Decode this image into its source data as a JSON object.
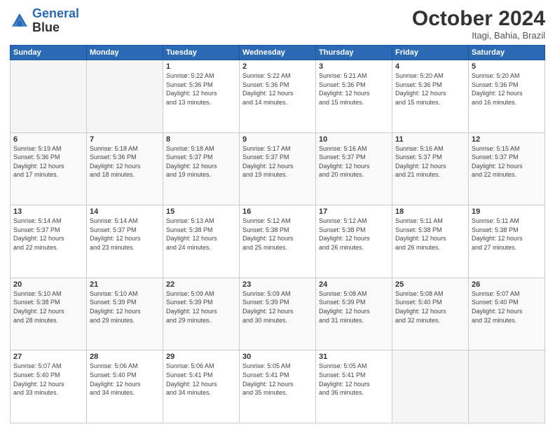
{
  "header": {
    "logo_line1": "General",
    "logo_line2": "Blue",
    "month": "October 2024",
    "location": "Itagi, Bahia, Brazil"
  },
  "weekdays": [
    "Sunday",
    "Monday",
    "Tuesday",
    "Wednesday",
    "Thursday",
    "Friday",
    "Saturday"
  ],
  "weeks": [
    [
      {
        "num": "",
        "info": ""
      },
      {
        "num": "",
        "info": ""
      },
      {
        "num": "1",
        "info": "Sunrise: 5:22 AM\nSunset: 5:36 PM\nDaylight: 12 hours\nand 13 minutes."
      },
      {
        "num": "2",
        "info": "Sunrise: 5:22 AM\nSunset: 5:36 PM\nDaylight: 12 hours\nand 14 minutes."
      },
      {
        "num": "3",
        "info": "Sunrise: 5:21 AM\nSunset: 5:36 PM\nDaylight: 12 hours\nand 15 minutes."
      },
      {
        "num": "4",
        "info": "Sunrise: 5:20 AM\nSunset: 5:36 PM\nDaylight: 12 hours\nand 15 minutes."
      },
      {
        "num": "5",
        "info": "Sunrise: 5:20 AM\nSunset: 5:36 PM\nDaylight: 12 hours\nand 16 minutes."
      }
    ],
    [
      {
        "num": "6",
        "info": "Sunrise: 5:19 AM\nSunset: 5:36 PM\nDaylight: 12 hours\nand 17 minutes."
      },
      {
        "num": "7",
        "info": "Sunrise: 5:18 AM\nSunset: 5:36 PM\nDaylight: 12 hours\nand 18 minutes."
      },
      {
        "num": "8",
        "info": "Sunrise: 5:18 AM\nSunset: 5:37 PM\nDaylight: 12 hours\nand 19 minutes."
      },
      {
        "num": "9",
        "info": "Sunrise: 5:17 AM\nSunset: 5:37 PM\nDaylight: 12 hours\nand 19 minutes."
      },
      {
        "num": "10",
        "info": "Sunrise: 5:16 AM\nSunset: 5:37 PM\nDaylight: 12 hours\nand 20 minutes."
      },
      {
        "num": "11",
        "info": "Sunrise: 5:16 AM\nSunset: 5:37 PM\nDaylight: 12 hours\nand 21 minutes."
      },
      {
        "num": "12",
        "info": "Sunrise: 5:15 AM\nSunset: 5:37 PM\nDaylight: 12 hours\nand 22 minutes."
      }
    ],
    [
      {
        "num": "13",
        "info": "Sunrise: 5:14 AM\nSunset: 5:37 PM\nDaylight: 12 hours\nand 22 minutes."
      },
      {
        "num": "14",
        "info": "Sunrise: 5:14 AM\nSunset: 5:37 PM\nDaylight: 12 hours\nand 23 minutes."
      },
      {
        "num": "15",
        "info": "Sunrise: 5:13 AM\nSunset: 5:38 PM\nDaylight: 12 hours\nand 24 minutes."
      },
      {
        "num": "16",
        "info": "Sunrise: 5:12 AM\nSunset: 5:38 PM\nDaylight: 12 hours\nand 25 minutes."
      },
      {
        "num": "17",
        "info": "Sunrise: 5:12 AM\nSunset: 5:38 PM\nDaylight: 12 hours\nand 26 minutes."
      },
      {
        "num": "18",
        "info": "Sunrise: 5:11 AM\nSunset: 5:38 PM\nDaylight: 12 hours\nand 26 minutes."
      },
      {
        "num": "19",
        "info": "Sunrise: 5:11 AM\nSunset: 5:38 PM\nDaylight: 12 hours\nand 27 minutes."
      }
    ],
    [
      {
        "num": "20",
        "info": "Sunrise: 5:10 AM\nSunset: 5:38 PM\nDaylight: 12 hours\nand 28 minutes."
      },
      {
        "num": "21",
        "info": "Sunrise: 5:10 AM\nSunset: 5:39 PM\nDaylight: 12 hours\nand 29 minutes."
      },
      {
        "num": "22",
        "info": "Sunrise: 5:09 AM\nSunset: 5:39 PM\nDaylight: 12 hours\nand 29 minutes."
      },
      {
        "num": "23",
        "info": "Sunrise: 5:09 AM\nSunset: 5:39 PM\nDaylight: 12 hours\nand 30 minutes."
      },
      {
        "num": "24",
        "info": "Sunrise: 5:08 AM\nSunset: 5:39 PM\nDaylight: 12 hours\nand 31 minutes."
      },
      {
        "num": "25",
        "info": "Sunrise: 5:08 AM\nSunset: 5:40 PM\nDaylight: 12 hours\nand 32 minutes."
      },
      {
        "num": "26",
        "info": "Sunrise: 5:07 AM\nSunset: 5:40 PM\nDaylight: 12 hours\nand 32 minutes."
      }
    ],
    [
      {
        "num": "27",
        "info": "Sunrise: 5:07 AM\nSunset: 5:40 PM\nDaylight: 12 hours\nand 33 minutes."
      },
      {
        "num": "28",
        "info": "Sunrise: 5:06 AM\nSunset: 5:40 PM\nDaylight: 12 hours\nand 34 minutes."
      },
      {
        "num": "29",
        "info": "Sunrise: 5:06 AM\nSunset: 5:41 PM\nDaylight: 12 hours\nand 34 minutes."
      },
      {
        "num": "30",
        "info": "Sunrise: 5:05 AM\nSunset: 5:41 PM\nDaylight: 12 hours\nand 35 minutes."
      },
      {
        "num": "31",
        "info": "Sunrise: 5:05 AM\nSunset: 5:41 PM\nDaylight: 12 hours\nand 36 minutes."
      },
      {
        "num": "",
        "info": ""
      },
      {
        "num": "",
        "info": ""
      }
    ]
  ]
}
